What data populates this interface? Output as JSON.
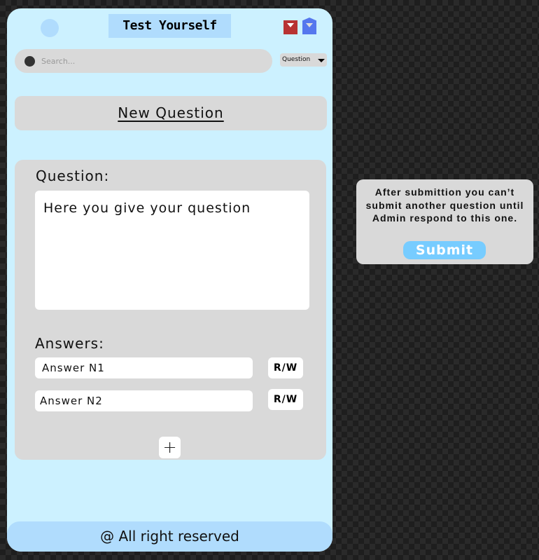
{
  "header": {
    "title": "Test Yourself",
    "icons": [
      "avatar-circle",
      "mail-red-icon",
      "mail-blue-icon"
    ]
  },
  "search": {
    "placeholder": "Search...",
    "filter": "Question"
  },
  "new_question": "New Question",
  "form": {
    "question_label": "Question:",
    "question_text": "Here you give your question",
    "answers_label": "Answers:",
    "answers": [
      {
        "text": "Answer N1",
        "toggle": "R/W"
      },
      {
        "text": "Answer N2",
        "toggle": "R/W"
      }
    ],
    "add": "+"
  },
  "footer": "@ All right reserved",
  "popup": {
    "message": "After submittion you can’t submit another question until Admin respond to this one.",
    "submit": "Submit"
  },
  "colors": {
    "panel": "#ccf1ff",
    "accent": "#b0dcfd",
    "submit": "#77ccff",
    "card": "#d9d9d9"
  }
}
